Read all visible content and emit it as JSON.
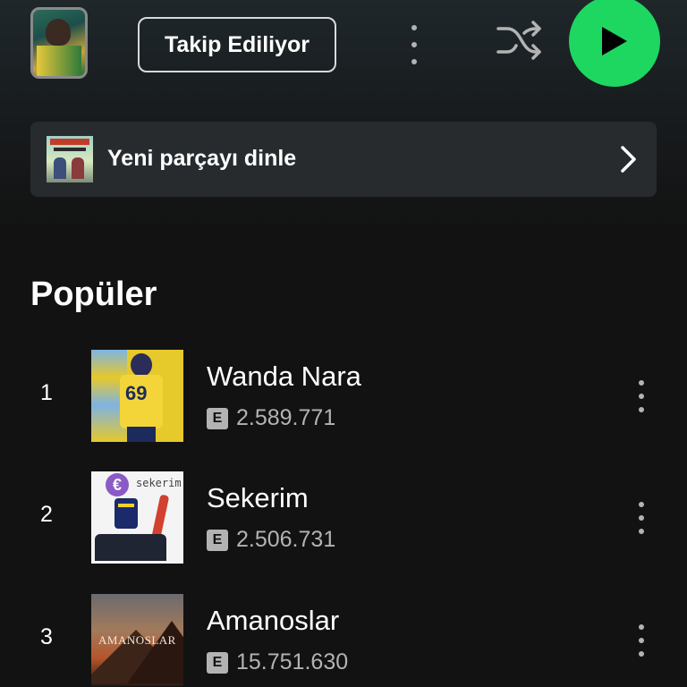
{
  "header": {
    "follow_label": "Takip Ediliyor"
  },
  "new_release": {
    "label": "Yeni parçayı dinle"
  },
  "popular": {
    "title": "Popüler",
    "tracks": [
      {
        "rank": "1",
        "title": "Wanda Nara",
        "explicit": "E",
        "plays": "2.589.771"
      },
      {
        "rank": "2",
        "title": "Sekerim",
        "explicit": "E",
        "plays": "2.506.731"
      },
      {
        "rank": "3",
        "title": "Amanoslar",
        "explicit": "E",
        "plays": "15.751.630"
      }
    ]
  },
  "colors": {
    "accent": "#1ed760",
    "background": "#121212",
    "banner": "#282b2d",
    "secondary_text": "#b3b3b3"
  },
  "icons": {
    "more": "more-vertical-icon",
    "shuffle": "shuffle-icon",
    "play": "play-icon",
    "chevron": "chevron-right-icon"
  }
}
